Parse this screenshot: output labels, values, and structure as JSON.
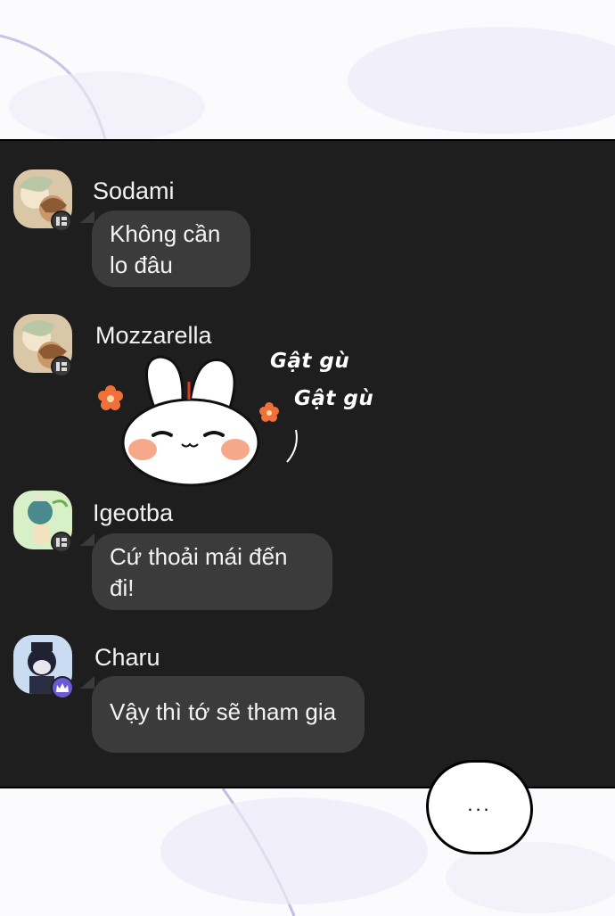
{
  "messages": [
    {
      "user": "Sodami",
      "text": "Không cần\nlo đâu",
      "badge": "member-badge-icon"
    },
    {
      "user": "Mozzarella",
      "sticker": {
        "caption_1": "Gật gù",
        "caption_2": "Gật gù"
      },
      "badge": "member-badge-icon"
    },
    {
      "user": "Igeotba",
      "text": "Cứ thoải mái đến\nđi!",
      "badge": "member-badge-icon"
    },
    {
      "user": "Charu",
      "text": "Vậy thì tớ sẽ tham gia",
      "badge": "crown-badge-icon"
    }
  ],
  "typing_indicator": {
    "text": "..."
  },
  "colors": {
    "chat_background": "#1e1e1e",
    "bubble": "#3b3b3b",
    "crown_badge": "#6a5ad6",
    "sticker_flower": "#f0703a"
  }
}
